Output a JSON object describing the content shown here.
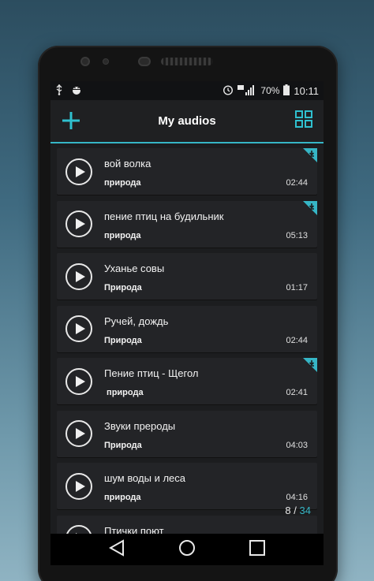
{
  "status": {
    "battery": "70%",
    "time": "10:11"
  },
  "appbar": {
    "title": "My audios"
  },
  "items": [
    {
      "title": "вой волка",
      "artist": "природа",
      "duration": "02:44",
      "downloaded": true
    },
    {
      "title": "пение птиц на будильник",
      "artist": "природа",
      "duration": "05:13",
      "downloaded": true
    },
    {
      "title": "Уханье совы",
      "artist": "Природа",
      "duration": "01:17",
      "downloaded": false
    },
    {
      "title": "Ручей, дождь",
      "artist": "Природа",
      "duration": "02:44",
      "downloaded": false
    },
    {
      "title": "Пение птиц - Щегол",
      "artist": " природа",
      "duration": "02:41",
      "downloaded": true
    },
    {
      "title": "Звуки прероды",
      "artist": "Природа",
      "duration": "04:03",
      "downloaded": false
    },
    {
      "title": "шум воды и леса",
      "artist": "природа",
      "duration": "04:16",
      "downloaded": false
    },
    {
      "title": "Птички поют",
      "artist": "",
      "duration": "",
      "downloaded": false
    }
  ],
  "counter": {
    "current": "8",
    "separator": "/",
    "total": "34"
  },
  "colors": {
    "accent": "#36b6c6",
    "background": "#1c1d1f"
  }
}
